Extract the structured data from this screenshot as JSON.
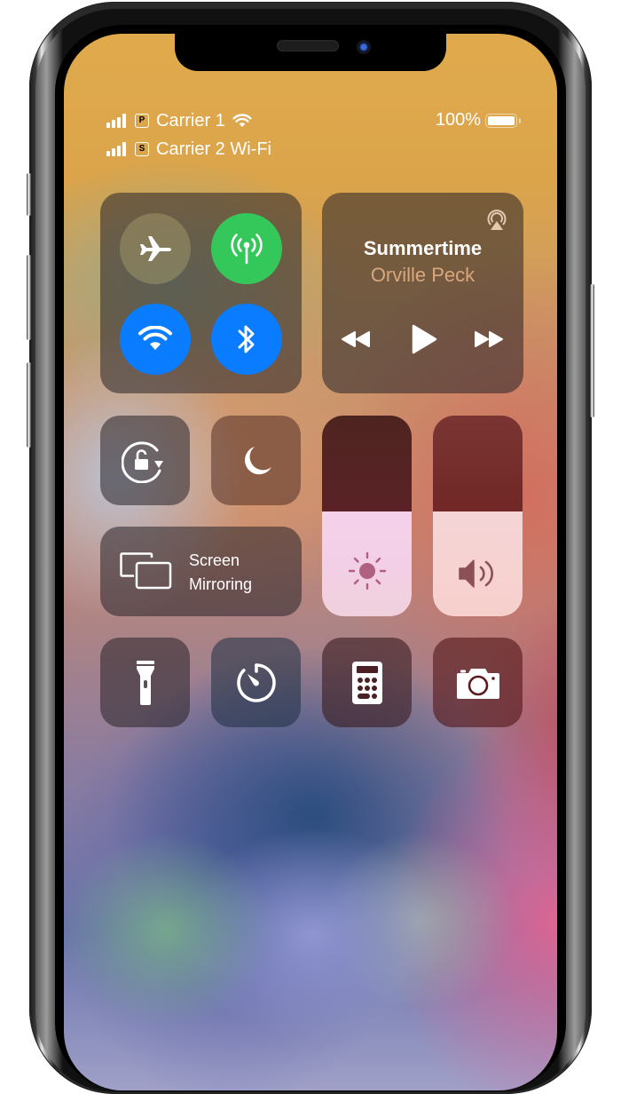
{
  "status_bar": {
    "carrier1": {
      "name": "Carrier 1",
      "sim_badge": "P",
      "signal_bars": 4,
      "wifi": true
    },
    "carrier2": {
      "name": "Carrier 2 Wi-Fi",
      "sim_badge": "S",
      "signal_bars": 4
    },
    "battery_text": "100%",
    "battery_level": 1.0
  },
  "connectivity": {
    "airplane": {
      "icon": "airplane-icon",
      "active": false
    },
    "cellular": {
      "icon": "cellular-antenna-icon",
      "active": true,
      "color": "#34c85a"
    },
    "wifi": {
      "icon": "wifi-icon",
      "active": true,
      "color": "#0a7cff"
    },
    "bluetooth": {
      "icon": "bluetooth-icon",
      "active": true,
      "color": "#0a7cff"
    }
  },
  "now_playing": {
    "title": "Summertime",
    "artist": "Orville Peck",
    "airplay_icon": "airplay-audio-icon",
    "controls": [
      "rewind-icon",
      "play-icon",
      "fast-forward-icon"
    ]
  },
  "toggles": {
    "orientation_lock": {
      "icon": "orientation-lock-icon"
    },
    "do_not_disturb": {
      "icon": "moon-icon"
    }
  },
  "screen_mirroring": {
    "label_line1": "Screen",
    "label_line2": "Mirroring",
    "icon": "screen-mirroring-icon"
  },
  "sliders": {
    "brightness": {
      "level": 0.52,
      "icon": "sun-icon"
    },
    "volume": {
      "level": 0.52,
      "icon": "speaker-icon"
    }
  },
  "shortcuts": [
    {
      "name": "flashlight",
      "icon": "flashlight-icon"
    },
    {
      "name": "timer",
      "icon": "timer-icon"
    },
    {
      "name": "calculator",
      "icon": "calculator-icon"
    },
    {
      "name": "camera",
      "icon": "camera-icon"
    }
  ],
  "colors": {
    "active_green": "#34c85a",
    "active_blue": "#0a7cff",
    "artist_text": "#d9a77d"
  }
}
